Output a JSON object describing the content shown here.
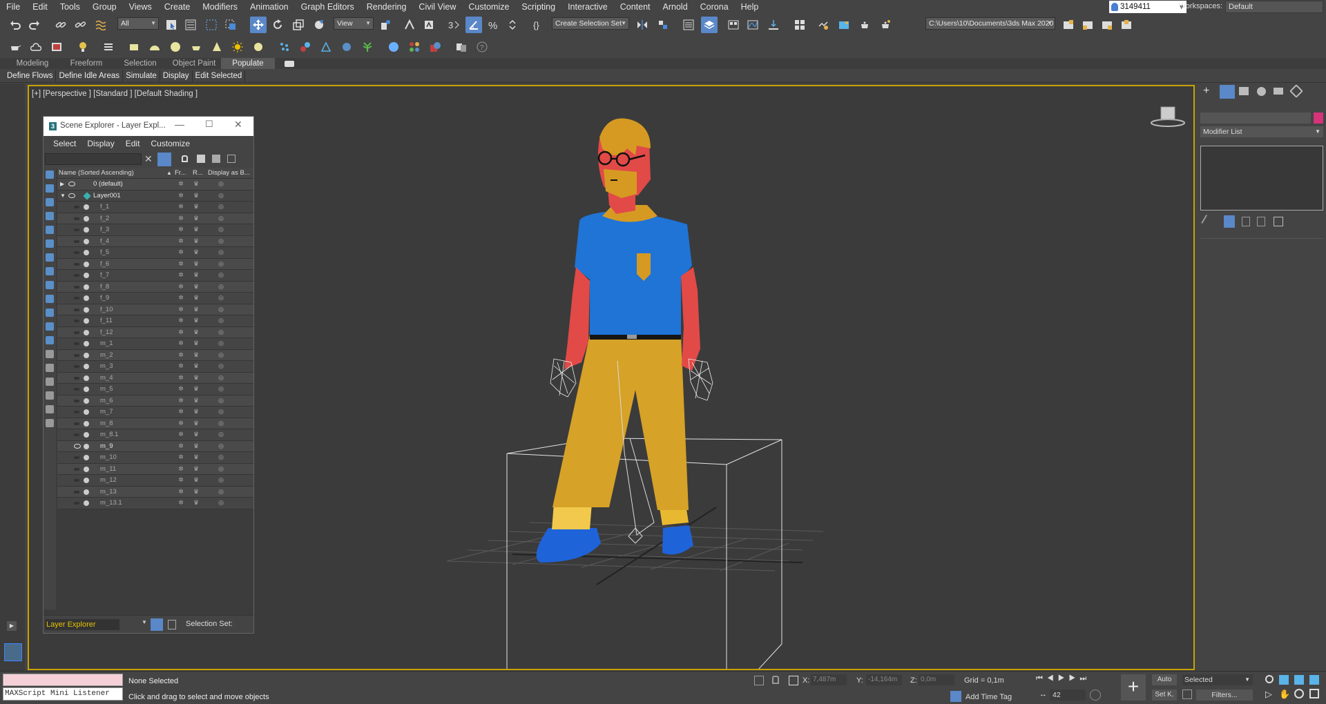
{
  "menubar": {
    "items": [
      "File",
      "Edit",
      "Tools",
      "Group",
      "Views",
      "Create",
      "Modifiers",
      "Animation",
      "Graph Editors",
      "Rendering",
      "Civil View",
      "Customize",
      "Scripting",
      "Interactive",
      "Content",
      "Arnold",
      "Corona",
      "Help"
    ],
    "account": "3149411",
    "workspaces_label": "Workspaces:",
    "workspace_value": "Default"
  },
  "toolbar": {
    "selection_filter": "All",
    "ref_coord": "View",
    "named_selection": "Create Selection Set",
    "project_path": "C:\\Users\\10\\Documents\\3ds Max 2020"
  },
  "ribbon": {
    "tabs": [
      "Modeling",
      "Freeform",
      "Selection",
      "Object Paint",
      "Populate"
    ],
    "active_tab": "Populate",
    "panel_items": [
      "Define Flows",
      "Define Idle Areas",
      "Simulate",
      "Display",
      "Edit Selected"
    ]
  },
  "viewport": {
    "label": "[+] [Perspective ] [Standard ] [Default Shading ]",
    "character_colors": {
      "shirt": "#1f74d6",
      "skin": "#e24a47",
      "pants": "#d6a227",
      "shoes": "#1f63d9",
      "hair": "#d69a22"
    }
  },
  "scene_explorer": {
    "title": "Scene Explorer - Layer Expl...",
    "menu": [
      "Select",
      "Display",
      "Edit",
      "Customize"
    ],
    "columns": {
      "name": "Name (Sorted Ascending)",
      "fr": "Fr...",
      "r": "R...",
      "display": "Display as B..."
    },
    "layers": [
      {
        "name": "0 (default)",
        "expanded": false
      },
      {
        "name": "Layer001",
        "expanded": true
      }
    ],
    "objects": [
      "f_1",
      "f_2",
      "f_3",
      "f_4",
      "f_5",
      "f_6",
      "f_7",
      "f_8",
      "f_9",
      "f_10",
      "f_11",
      "f_12",
      "m_1",
      "m_2",
      "m_3",
      "m_4",
      "m_5",
      "m_6",
      "m_7",
      "m_8",
      "m_8.1",
      "m_9",
      "m_10",
      "m_11",
      "m_12",
      "m_13",
      "m_13.1"
    ],
    "visible_object": "m_9",
    "bottom_layer": "Layer Explorer",
    "selection_set_label": "Selection Set:"
  },
  "command_panel": {
    "modifier_list": "Modifier List",
    "color_swatch": "#d6337a"
  },
  "status": {
    "maxscript": "MAXScript Mini Listener",
    "selection": "None Selected",
    "prompt": "Click and drag to select and move objects",
    "x_label": "X:",
    "x_value": "7,487m",
    "y_label": "Y:",
    "y_value": "-14,164m",
    "z_label": "Z:",
    "z_value": "0,0m",
    "grid": "Grid = 0,1m",
    "add_time_tag": "Add Time Tag",
    "auto": "Auto",
    "set_key": "Set K.",
    "key_filter": "Selected",
    "filters": "Filters...",
    "frame": "42"
  }
}
